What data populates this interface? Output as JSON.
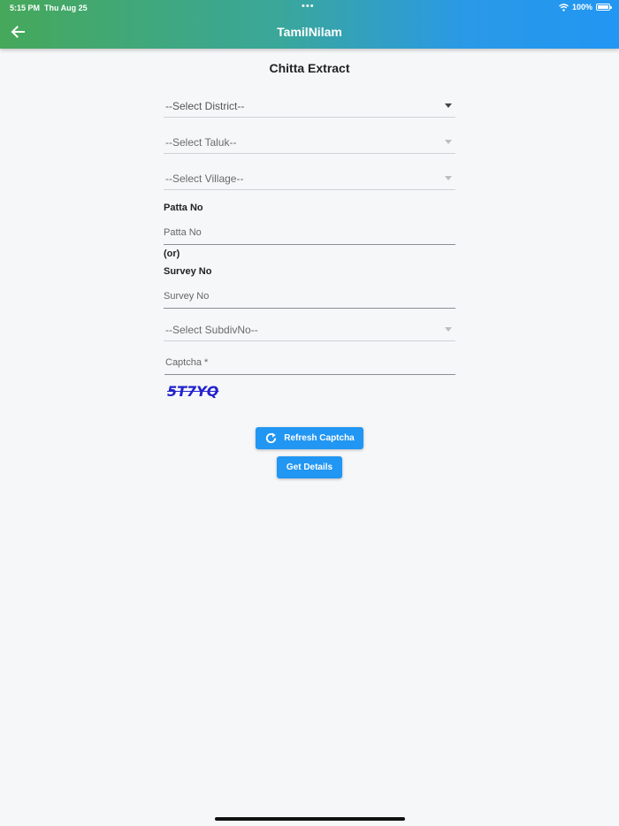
{
  "status_bar": {
    "time": "5:15 PM",
    "date": "Thu Aug 25",
    "dots": "•••",
    "battery_percent": "100%"
  },
  "header": {
    "title": "TamilNilam",
    "back_icon": "arrow-left-icon",
    "gradient_start": "#46a85a",
    "gradient_end": "#2196f3"
  },
  "form": {
    "title": "Chitta Extract",
    "district_select": "--Select District--",
    "taluk_select": "--Select Taluk--",
    "village_select": "--Select Village--",
    "patta_label": "Patta No",
    "patta_placeholder": "Patta No",
    "or_label": "(or)",
    "survey_label": "Survey No",
    "survey_placeholder": "Survey No",
    "subdiv_select": "--Select SubdivNo--",
    "captcha_placeholder": "Captcha *",
    "captcha_code": "5T7YQ",
    "refresh_button": "Refresh Captcha",
    "refresh_icon": "refresh-icon",
    "details_button": "Get Details",
    "accent": "#2196f3"
  }
}
